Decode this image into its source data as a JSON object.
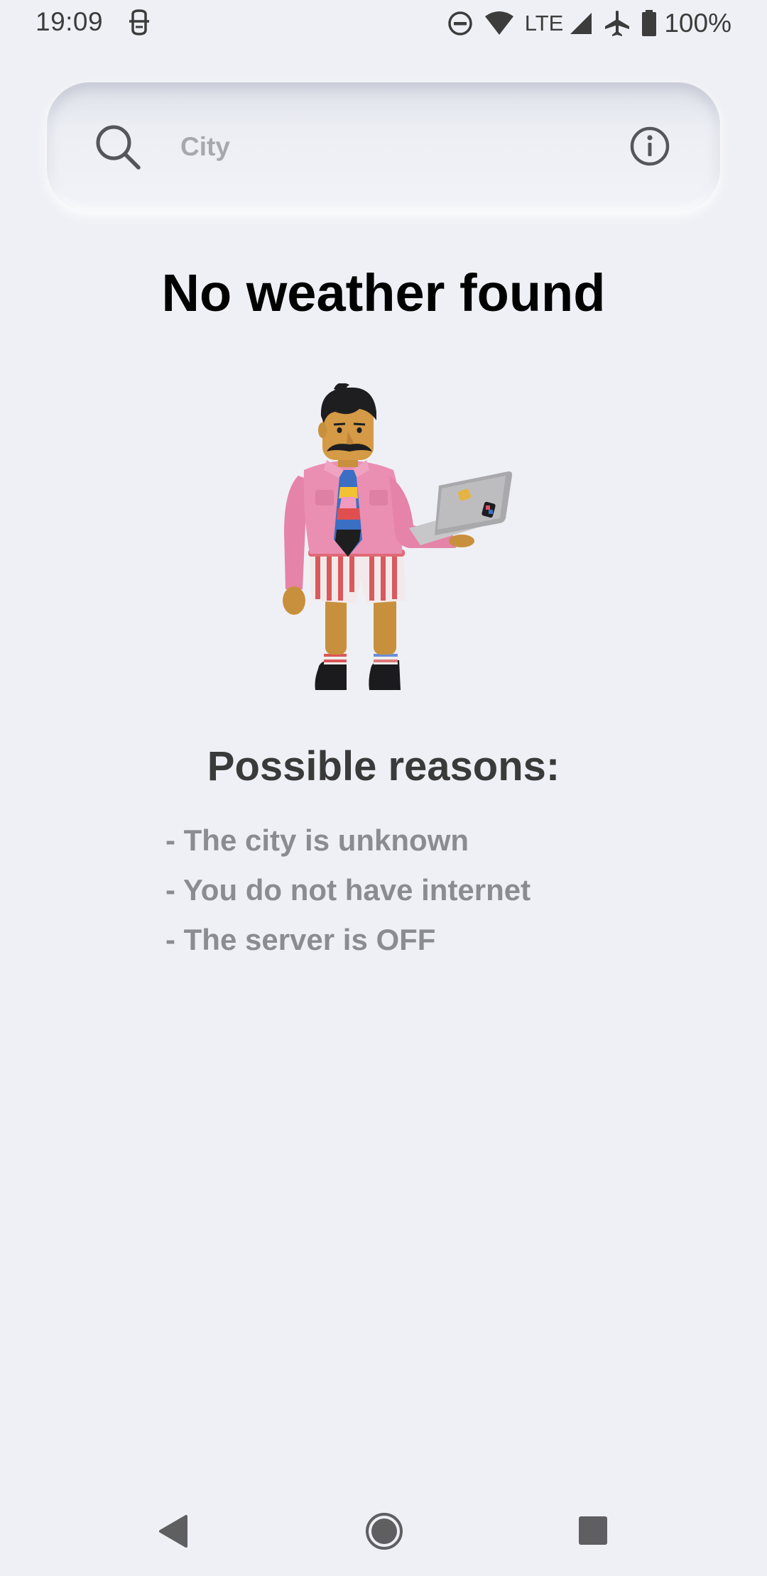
{
  "status_bar": {
    "time": "19:09",
    "network": "LTE",
    "battery": "100%",
    "icons": [
      "assistant-icon",
      "dnd-icon",
      "wifi-icon",
      "signal-icon",
      "airplane-icon",
      "battery-icon"
    ]
  },
  "search": {
    "placeholder": "City",
    "value": "",
    "icon": "search-icon",
    "info_icon": "info-icon"
  },
  "main": {
    "title": "No weather found",
    "reasons_title": "Possible reasons:",
    "reasons": [
      "- The city is unknown",
      "- You do not have internet",
      "- The server is OFF"
    ]
  },
  "nav_bar": {
    "icons": [
      "back-icon",
      "home-icon",
      "recent-apps-icon"
    ]
  },
  "colors": {
    "background": "#eff0f5",
    "title": "#000000",
    "reasons_title": "#3a3a3a",
    "reason_text": "#8b8c90",
    "placeholder": "#a7a8ad"
  }
}
